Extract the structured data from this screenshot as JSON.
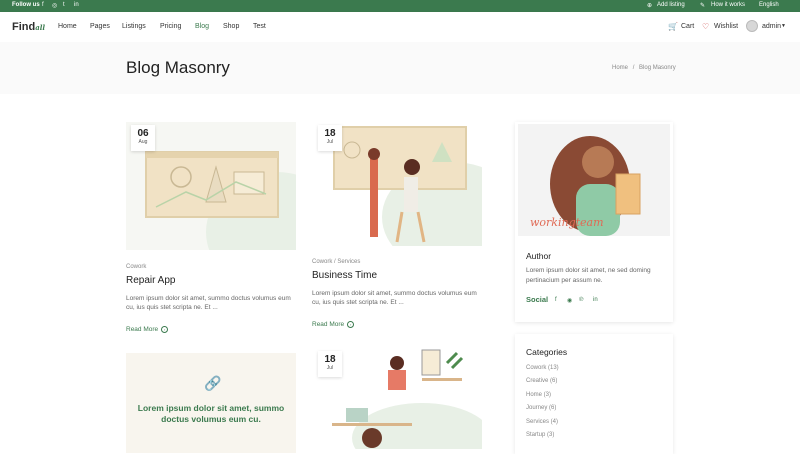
{
  "topbar": {
    "follow": "Follow us",
    "social": [
      "f",
      "◎",
      "t",
      "in"
    ],
    "add_listing": "Add listing",
    "how_it_works": "How it works",
    "language": "English"
  },
  "nav": {
    "logo_main": "Find",
    "logo_script": "all",
    "items": [
      {
        "label": "Home"
      },
      {
        "label": "Pages"
      },
      {
        "label": "Listings"
      },
      {
        "label": "Pricing"
      },
      {
        "label": "Blog"
      },
      {
        "label": "Shop"
      },
      {
        "label": "Test"
      }
    ],
    "cart": "Cart",
    "wishlist": "Wishlist",
    "user": "admin"
  },
  "hero": {
    "title": "Blog Masonry",
    "crumb_home": "Home",
    "crumb_sep": "/",
    "crumb_current": "Blog Masonry"
  },
  "posts": [
    {
      "day": "06",
      "month": "Aug",
      "category": "Cowork",
      "title": "Repair App",
      "excerpt": "Lorem ipsum dolor sit amet, summo doctus volumus eum cu, ius quis stet scripta ne. Et ...",
      "more": "Read More"
    },
    {
      "day": "18",
      "month": "Jul",
      "category": "Cowork / Services",
      "title": "Business Time",
      "excerpt": "Lorem ipsum dolor sit amet, summo doctus volumus eum cu, ius quis stet scripta ne. Et ...",
      "more": "Read More"
    },
    {
      "day": "18",
      "month": "Jul"
    }
  ],
  "quote": {
    "text": "Lorem ipsum dolor sit amet, summo doctus volumus eum cu."
  },
  "sidebar": {
    "author_title": "Author",
    "author_script": "workingteam",
    "author_bio": "Lorem ipsum dolor sit amet, ne sed doming pertinacium per assum ne.",
    "social_label": "Social",
    "social_icons": [
      "f",
      "◉",
      "℗",
      "in"
    ],
    "categories_title": "Categories",
    "categories": [
      "Cowork (13)",
      "Creative (6)",
      "Home (3)",
      "Journey (6)",
      "Services (4)",
      "Startup (3)"
    ]
  },
  "colors": {
    "brand": "#3b7a4e",
    "hero_bg": "#fafafa"
  }
}
